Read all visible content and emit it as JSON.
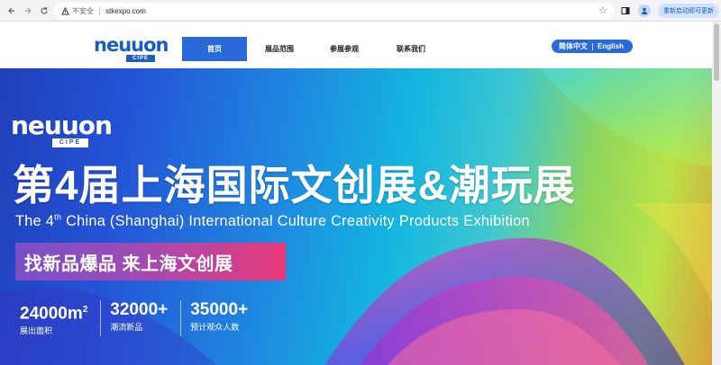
{
  "browser": {
    "security_label": "不安全",
    "url": "stkexpo.com",
    "update_label": "重新启动即可更新"
  },
  "header": {
    "logo_text": "neuuon",
    "logo_sub": "CIPE",
    "nav": [
      "首页",
      "展品范围",
      "参展参观",
      "联系我们"
    ],
    "active_nav": "首页",
    "lang_zh": "简体中文",
    "lang_en": "English"
  },
  "hero": {
    "logo_text": "neuuon",
    "logo_sub": "CIPE",
    "title": "第4届上海国际文创展&潮玩展",
    "subtitle_pre": "The 4",
    "subtitle_sup": "th",
    "subtitle_post": " China (Shanghai) International Culture Creativity Products Exhibition",
    "slogan": "找新品爆品 来上海文创展",
    "stats": [
      {
        "value": "24000m",
        "sup": "2",
        "label": "展出面积"
      },
      {
        "value": "32000+",
        "sup": "",
        "label": "潮流新品"
      },
      {
        "value": "35000+",
        "sup": "",
        "label": "预计观众人数"
      }
    ]
  },
  "colors": {
    "brand_blue": "#2a69d8",
    "logo_blue": "#1a5fbe",
    "slogan_start": "#7a4fc8",
    "slogan_end": "#e83a7a"
  }
}
